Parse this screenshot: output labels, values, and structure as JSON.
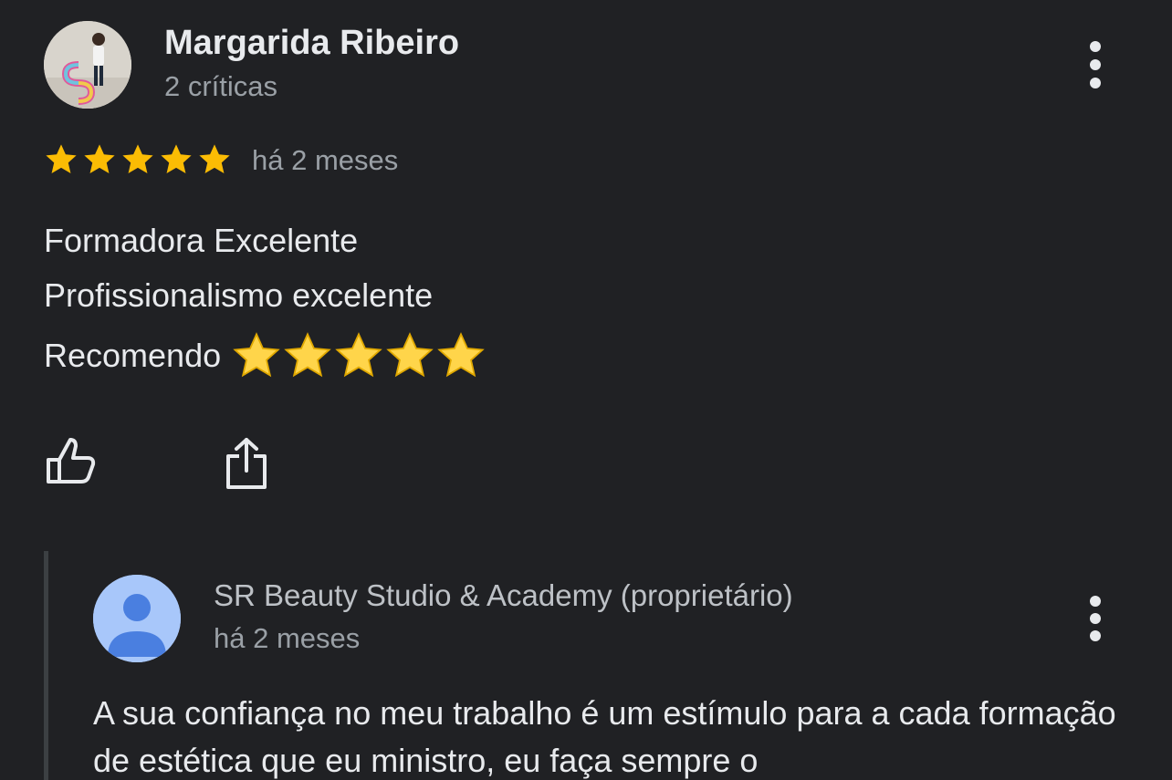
{
  "colors": {
    "background": "#202124",
    "text_primary": "#e8eaed",
    "text_secondary": "#9aa0a6",
    "star": "#fbbc04",
    "owner_avatar": "#a8c7fa"
  },
  "review": {
    "reviewer_name": "Margarida Ribeiro",
    "reviewer_reviews": "2 críticas",
    "rating": 5,
    "rating_max": 5,
    "date": "há 2 meses",
    "lines": [
      "Formadora Excelente",
      "Profissionalismo excelente",
      "Recomendo"
    ],
    "emoji_stars": 5,
    "icons": {
      "like": "thumbs-up-icon",
      "share": "share-icon",
      "more": "more-vert-icon"
    }
  },
  "reply": {
    "owner_name": "SR Beauty Studio & Academy (proprietário)",
    "date": "há 2 meses",
    "text": "A sua confiança no meu trabalho é um estímulo para a cada formação de estética que eu ministro, eu faça sempre o"
  }
}
